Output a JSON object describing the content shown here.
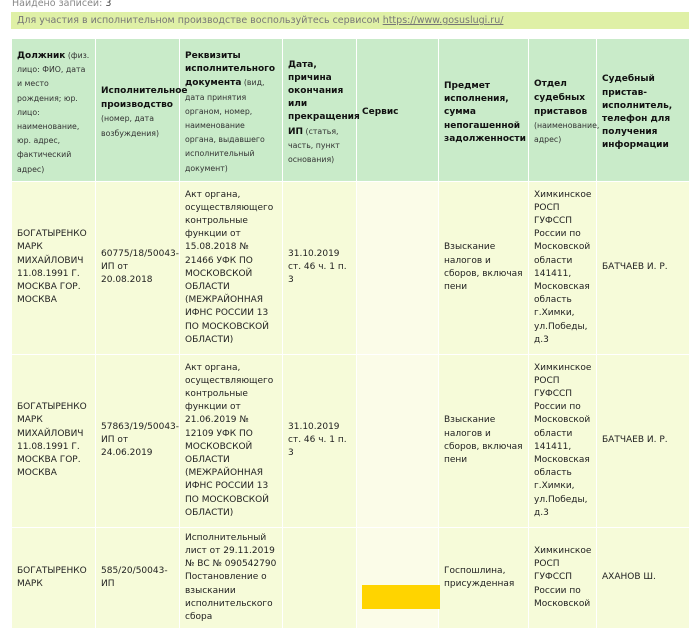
{
  "found": {
    "label": "Найдено записей:",
    "count": "3"
  },
  "notice": {
    "text": "Для участия в исполнительном производстве воспользуйтесь сервисом ",
    "link": "https://www.gosuslugi.ru/"
  },
  "headers": [
    {
      "title": "Должник",
      "sub": " (физ. лицо: ФИО, дата и место рождения; юр. лицо: наименование, юр. адрес, фактический адрес)"
    },
    {
      "title": "Исполнительное производство",
      "sub": " (номер, дата возбуждения)"
    },
    {
      "title": "Реквизиты исполнительного документа",
      "sub": " (вид, дата принятия органом, номер, наименование органа, выдавшего исполнительный документ)"
    },
    {
      "title": "Дата, причина окончания или прекращения ИП",
      "sub": " (статья, часть, пункт основания)"
    },
    {
      "title": "Сервис",
      "sub": ""
    },
    {
      "title": "Предмет исполнения, сумма непогашенной задолженности",
      "sub": ""
    },
    {
      "title": "Отдел судебных приставов",
      "sub": " (наименование, адрес)"
    },
    {
      "title": "Судебный пристав-исполнитель, телефон для получения информации",
      "sub": ""
    }
  ],
  "rows": [
    {
      "debtor": "БОГАТЫРЕНКО МАРК МИХАЙЛОВИЧ 11.08.1991 Г. МОСКВА ГОР. МОСКВА",
      "proceeding": "60775/18/50043-ИП от 20.08.2018",
      "document": "Акт органа, осуществляющего контрольные функции от 15.08.2018 № 21466 УФК ПО МОСКОВСКОЙ ОБЛАСТИ (МЕЖРАЙОННАЯ ИФНС РОССИИ 13 ПО МОСКОВСКОЙ ОБЛАСТИ)",
      "end": "31.10.2019 ст. 46 ч. 1 п. 3",
      "subject": "Взыскание налогов и сборов, включая пени",
      "department": "Химкинское РОСП ГУФССП России по Московской области 141411, Московская область г.Химки, ул.Победы, д.3",
      "bailiff": "БАТЧАЕВ И. Р."
    },
    {
      "debtor": "БОГАТЫРЕНКО МАРК МИХАЙЛОВИЧ 11.08.1991 Г. МОСКВА ГОР. МОСКВА",
      "proceeding": "57863/19/50043-ИП от 24.06.2019",
      "document": "Акт органа, осуществляющего контрольные функции от 21.06.2019 № 12109 УФК ПО МОСКОВСКОЙ ОБЛАСТИ (МЕЖРАЙОННАЯ ИФНС РОССИИ 13 ПО МОСКОВСКОЙ ОБЛАСТИ)",
      "end": "31.10.2019 ст. 46 ч. 1 п. 3",
      "subject": "Взыскание налогов и сборов, включая пени",
      "department": "Химкинское РОСП ГУФССП России по Московской области 141411, Московская область г.Химки, ул.Победы, д.3",
      "bailiff": "БАТЧАЕВ И. Р."
    },
    {
      "debtor": "БОГАТЫРЕНКО МАРК",
      "proceeding": "585/20/50043-ИП",
      "document": "Исполнительный лист от 29.11.2019 № ВС № 090542790 Постановление о взыскании исполнительского сбора",
      "end": "",
      "subject": "Госпошлина, присужденная",
      "department": "Химкинское РОСП ГУФССП России по Московской",
      "bailiff": "АХАНОВ Ш."
    }
  ]
}
